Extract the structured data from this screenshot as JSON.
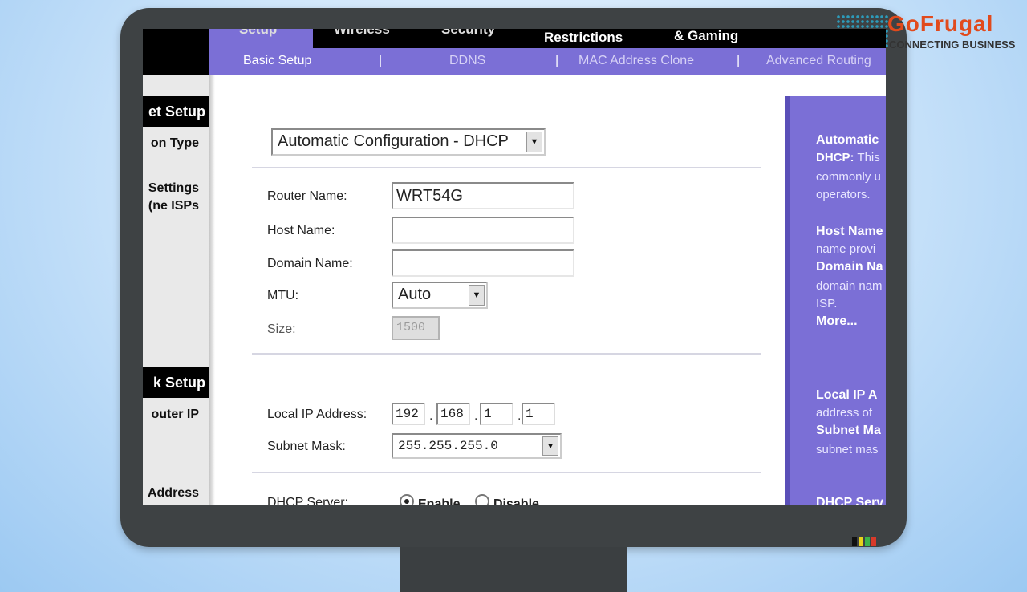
{
  "brand": {
    "title": "GoFrugal",
    "subtitle": "CONNECTING BUSINESS",
    "title_color": "#e14a1c"
  },
  "nav": {
    "tabs": [
      "Setup",
      "Wireless",
      "Security",
      "Restrictions",
      "& Gaming"
    ],
    "subtabs": [
      "Basic Setup",
      "DDNS",
      "MAC Address Clone",
      "Advanced Routing"
    ],
    "separator": "|",
    "accent": "#7b6fd6"
  },
  "left": {
    "section1_title": "et Setup",
    "label_type": "on Type",
    "label_settings_1": "Settings",
    "label_settings_2": "ne ISPs)",
    "section2_title": "k Setup",
    "label_router_ip": "outer IP",
    "label_address": "Address"
  },
  "form": {
    "connection_type": "Automatic Configuration - DHCP",
    "router_name_label": "Router Name:",
    "router_name_value": "WRT54G",
    "host_name_label": "Host Name:",
    "host_name_value": "",
    "domain_name_label": "Domain Name:",
    "domain_name_value": "",
    "mtu_label": "MTU:",
    "mtu_value": "Auto",
    "size_label": "Size:",
    "size_value": "1500",
    "local_ip_label": "Local IP Address:",
    "ip_octets": [
      "192",
      "168",
      "1",
      "1"
    ],
    "ip_dot": ".",
    "subnet_label": "Subnet Mask:",
    "subnet_value": "255.255.255.0",
    "dhcp_label": "DHCP Server:",
    "dhcp_enable": "Enable",
    "dhcp_disable": "Disable"
  },
  "help": {
    "l1": "Automatic",
    "l2_bold": "DHCP:",
    "l2_rest": "This",
    "l3": "commonly u",
    "l4": "operators.",
    "l5": "Host Name",
    "l6": "name provi",
    "l7": "Domain Na",
    "l8": "domain nam",
    "l9": "ISP.",
    "l10": "More...",
    "l11": "Local IP A",
    "l12": "address of",
    "l13": "Subnet Ma",
    "l14": "subnet mas",
    "l15": "DHCP Serv"
  }
}
